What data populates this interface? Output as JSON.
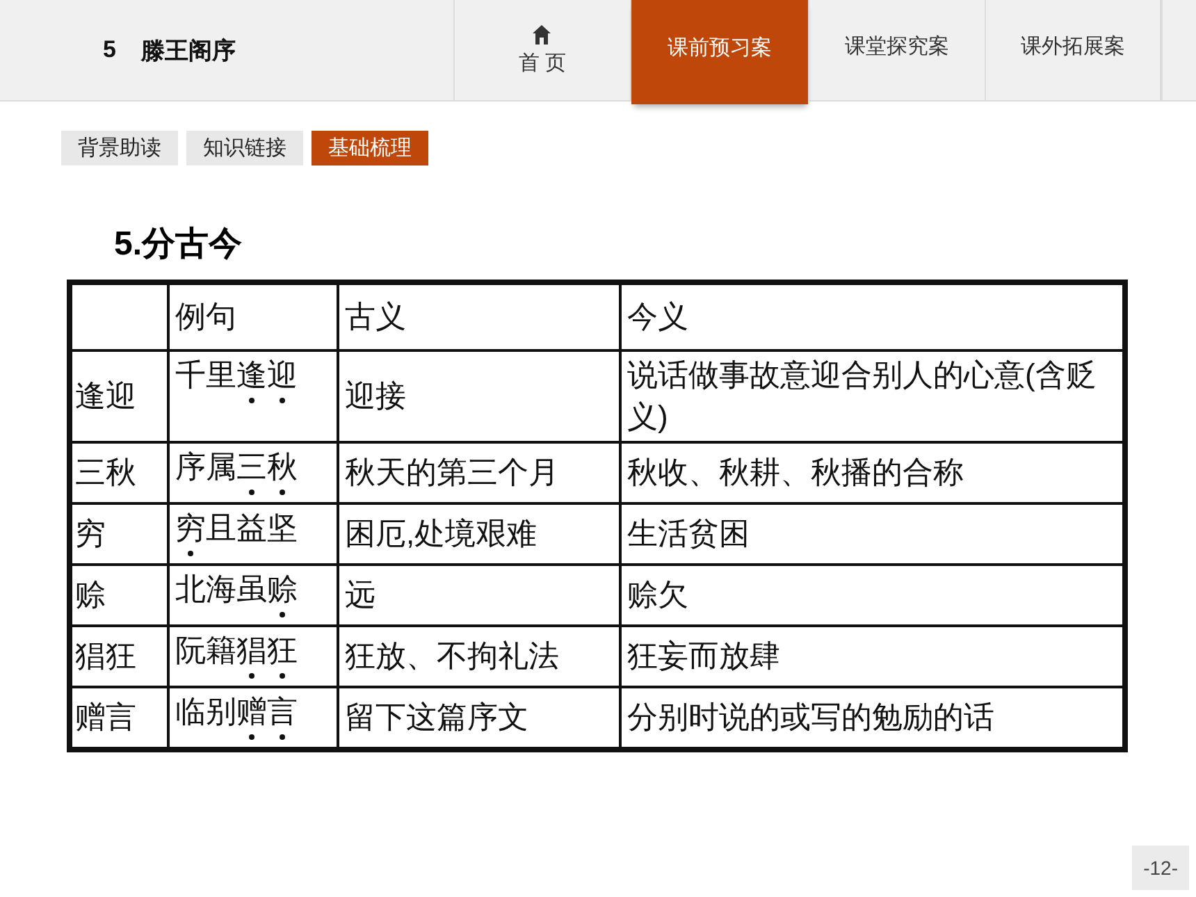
{
  "header": {
    "lesson_number": "5",
    "lesson_title": "滕王阁序",
    "home": {
      "label": "首 页"
    },
    "tabs": [
      {
        "label": "课前预习案",
        "selected": true
      },
      {
        "label": "课堂探究案",
        "selected": false
      },
      {
        "label": "课外拓展案",
        "selected": false
      }
    ]
  },
  "subtabs": [
    {
      "label": "背景助读",
      "selected": false
    },
    {
      "label": "知识链接",
      "selected": false
    },
    {
      "label": "基础梳理",
      "selected": true
    }
  ],
  "section_title": "5.分古今",
  "table": {
    "columns": [
      "",
      "例句",
      "古义",
      "今义"
    ],
    "rows": [
      {
        "word": "逢迎",
        "example": [
          {
            "text": "千里",
            "dotted": false
          },
          {
            "text": "逢迎",
            "dotted": true
          }
        ],
        "ancient": "迎接",
        "modern": "说话做事故意迎合别人的心意(含贬义)"
      },
      {
        "word": "三秋",
        "example": [
          {
            "text": "序属",
            "dotted": false
          },
          {
            "text": "三秋",
            "dotted": true
          }
        ],
        "ancient": "秋天的第三个月",
        "modern": "秋收、秋耕、秋播的合称"
      },
      {
        "word": "穷",
        "example": [
          {
            "text": "穷",
            "dotted": true
          },
          {
            "text": "且益坚",
            "dotted": false
          }
        ],
        "ancient": "困厄,处境艰难",
        "modern": "生活贫困"
      },
      {
        "word": "赊",
        "example": [
          {
            "text": "北海虽",
            "dotted": false
          },
          {
            "text": "赊",
            "dotted": true
          }
        ],
        "ancient": "远",
        "modern": "赊欠"
      },
      {
        "word": "猖狂",
        "example": [
          {
            "text": "阮籍",
            "dotted": false
          },
          {
            "text": "猖狂",
            "dotted": true
          }
        ],
        "ancient": "狂放、不拘礼法",
        "modern": "狂妄而放肆"
      },
      {
        "word": "赠言",
        "example": [
          {
            "text": "临别",
            "dotted": false
          },
          {
            "text": "赠言",
            "dotted": true
          }
        ],
        "ancient": "留下这篇序文",
        "modern": "分别时说的或写的勉励的话"
      }
    ]
  },
  "page_number": "-12-"
}
